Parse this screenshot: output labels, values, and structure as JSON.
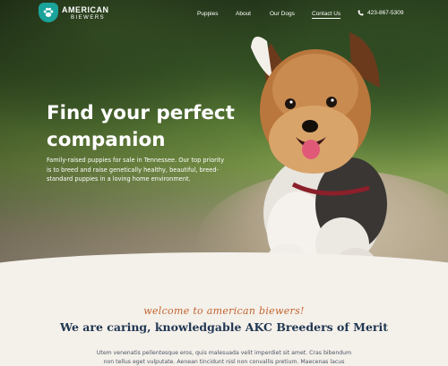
{
  "brand": {
    "line1": "AMERICAN",
    "line2": "BIEWERS",
    "accent_color": "#1aa39b"
  },
  "nav": {
    "items": [
      "Puppies",
      "About",
      "Our Dogs",
      "Contact Us"
    ],
    "active": "Contact Us",
    "phone": "423-867-5309",
    "phone_icon": "phone-icon"
  },
  "hero": {
    "title_line1": "Find your perfect",
    "title_line2": "companion",
    "subtitle": "Family-raised puppies for sale in Tennessee. Our top priority is to breed and raise genetically healthy, beautiful, breed-standard puppies in a loving home environment."
  },
  "intro": {
    "kicker": "welcome to american biewers!",
    "kicker_color": "#c2642f",
    "heading": "We are caring, knowledgable AKC Breeders of Merit",
    "heading_color": "#1f3651",
    "body": "Utem venenatis pellentesque eros, quis malesuada velit imperdiet sit amet. Cras bibendum non tellus eget vulputate. Aenean tincidunt nisl non convallis pretium. Maecenas lacus purus, iaculis sed quam sit"
  }
}
